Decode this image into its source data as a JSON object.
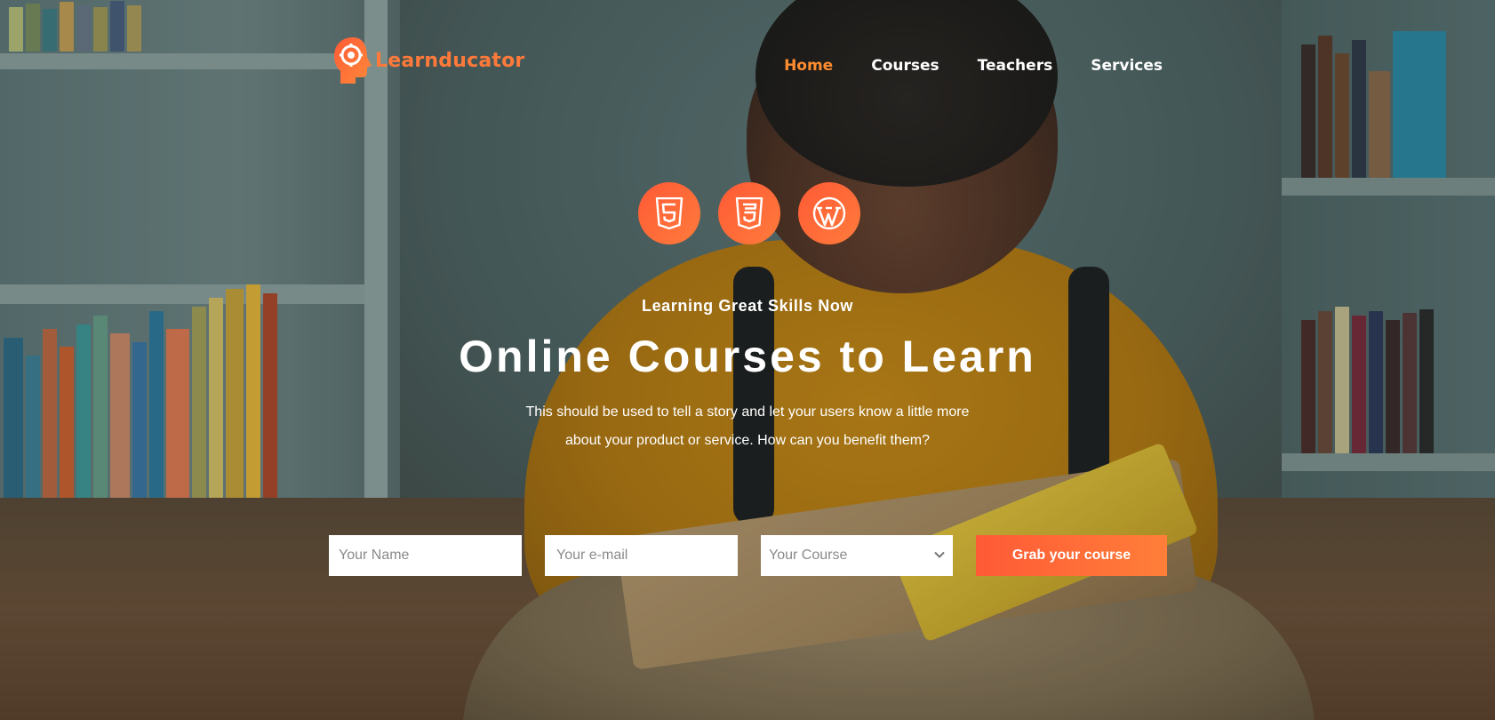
{
  "brand": {
    "name": "Learnducator",
    "logo_icon": "head-gear-icon",
    "accent": "#ff7a3a"
  },
  "nav": {
    "items": [
      {
        "label": "Home",
        "active": true
      },
      {
        "label": "Courses",
        "active": false
      },
      {
        "label": "Teachers",
        "active": false
      },
      {
        "label": "Services",
        "active": false
      }
    ],
    "active_color": "#ff8c2e"
  },
  "tech_icons": [
    "html5-icon",
    "css3-icon",
    "wordpress-icon"
  ],
  "hero": {
    "kicker": "Learning Great Skills Now",
    "headline": "Online Courses to Learn",
    "description_line1": "This should be used to tell a story and let your users know a little more",
    "description_line2": "about your product or service. How can you benefit them?"
  },
  "form": {
    "name_placeholder": "Your Name",
    "email_placeholder": "Your e-mail",
    "course_selected": "Your Course",
    "submit_label": "Grab your course"
  },
  "colors": {
    "cta_start": "#ff5a36",
    "cta_end": "#ff7e39"
  }
}
